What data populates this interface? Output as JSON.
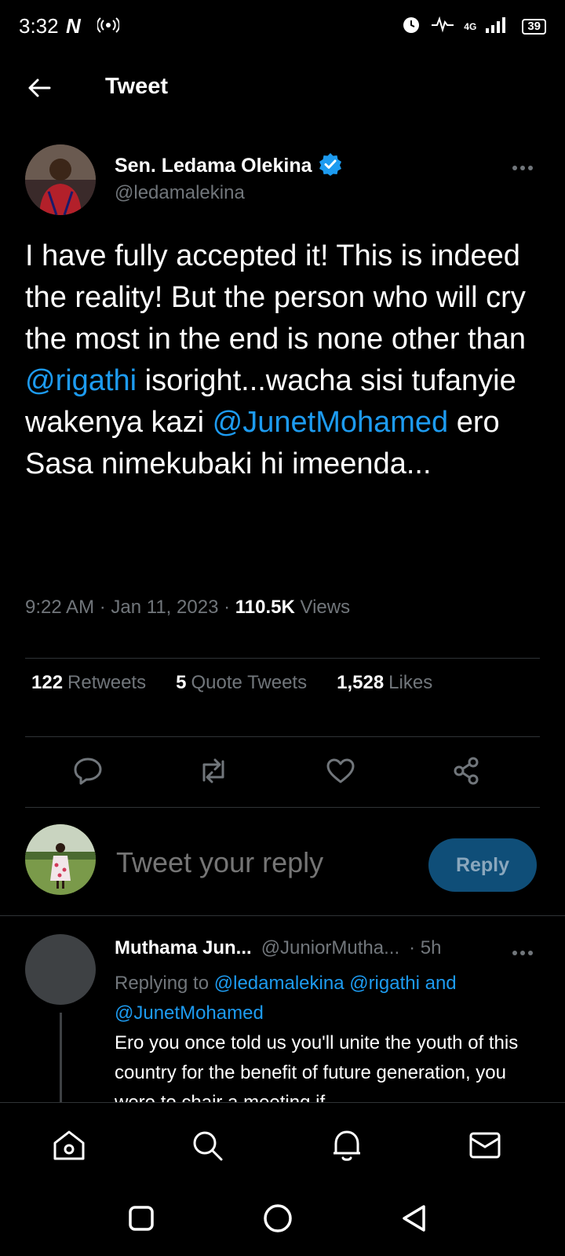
{
  "status_bar": {
    "time": "3:32",
    "app_badge": "N",
    "network": "4G",
    "battery": "39"
  },
  "header": {
    "title": "Tweet"
  },
  "tweet": {
    "author_name": "Sen. Ledama Olekina",
    "author_handle": "@ledamalekina",
    "verified": true,
    "text_parts": {
      "p1": "I have fully accepted it! This is indeed the reality! But the person who will cry the most in the end is none other than ",
      "m1": "@rigathi",
      "p2": " isoright...wacha sisi tufanyie wakenya kazi ",
      "m2": "@JunetMohamed",
      "p3": " ero Sasa nimekubaki hi imeenda..."
    },
    "time": "9:22 AM",
    "date": "Jan 11, 2023",
    "views_count": "110.5K",
    "views_label": "Views",
    "stats": {
      "retweets_count": "122",
      "retweets_label": "Retweets",
      "quotes_count": "5",
      "quotes_label": "Quote Tweets",
      "likes_count": "1,528",
      "likes_label": "Likes"
    }
  },
  "composer": {
    "placeholder": "Tweet your reply",
    "reply_button": "Reply"
  },
  "reply": {
    "name": "Muthama Jun...",
    "handle": "@JuniorMutha...",
    "time": "· 5h",
    "replying_prefix": "Replying to",
    "replying_mentions": "@ledamalekina @rigathi and @JunetMohamed",
    "text": "Ero you once told us you'll unite the youth of this country for the benefit of future generation, you were to chair a meeting if"
  },
  "colors": {
    "accent": "#1d9bf0",
    "muted": "#71767b",
    "background": "#000000"
  },
  "icons": {
    "nav": [
      "home-icon",
      "search-icon",
      "notifications-icon",
      "messages-icon"
    ],
    "actions": [
      "reply-icon",
      "retweet-icon",
      "like-icon",
      "share-icon"
    ],
    "system": [
      "recents-icon",
      "home-circle-icon",
      "back-triangle-icon"
    ]
  }
}
